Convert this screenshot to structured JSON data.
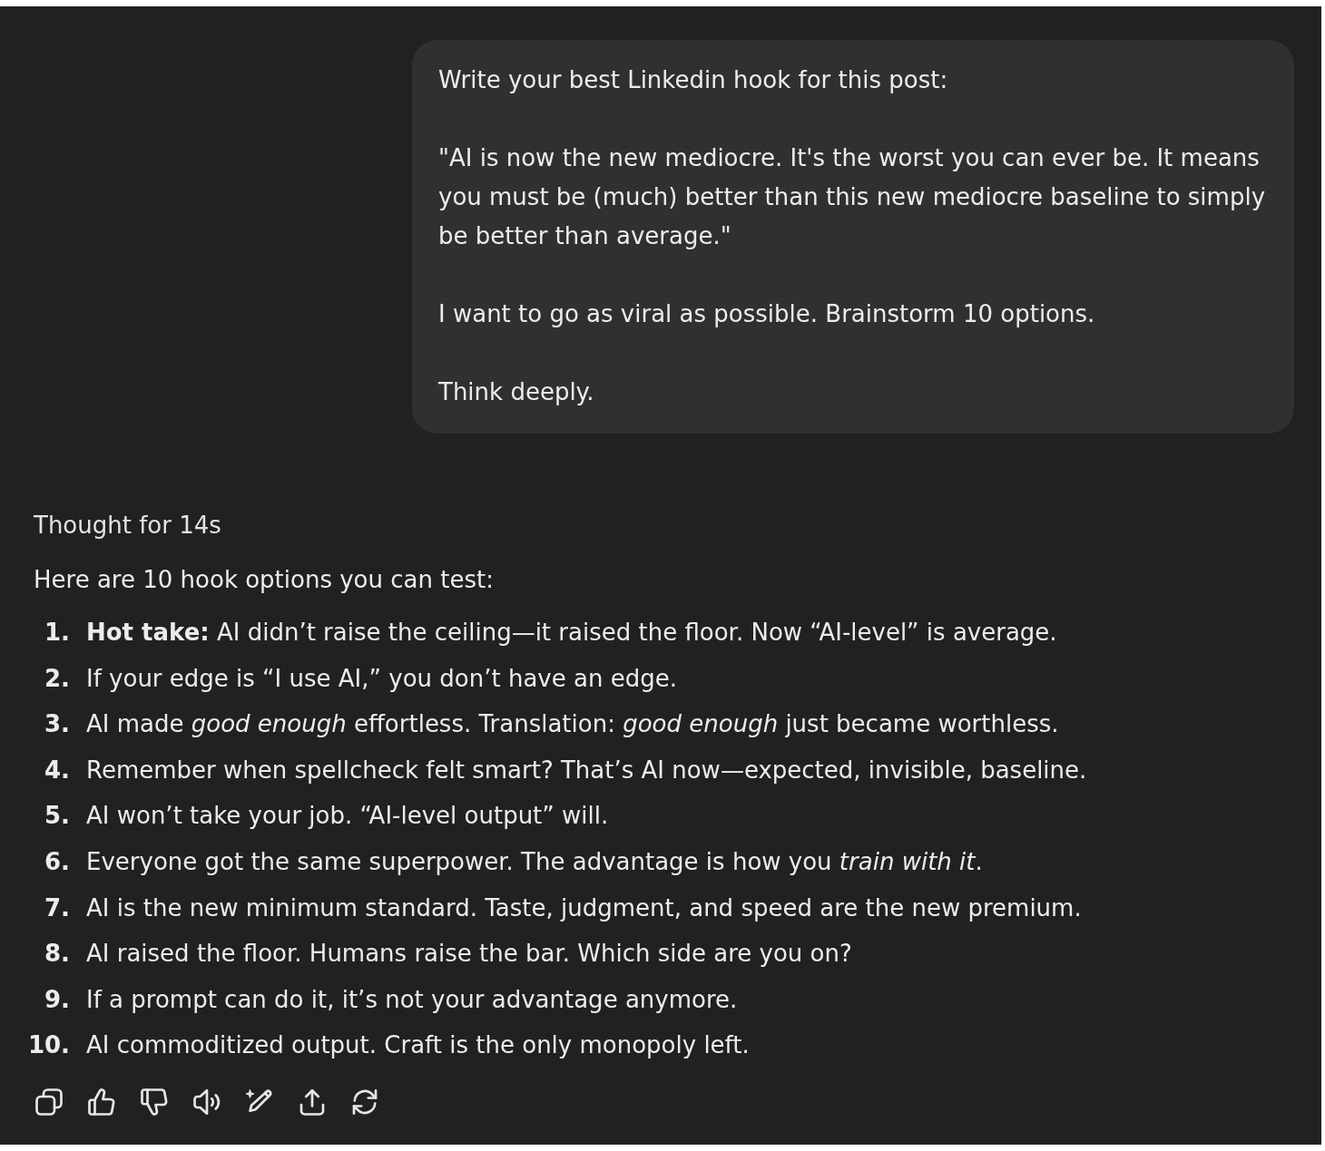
{
  "user_message": {
    "paragraphs": [
      "Write your best Linkedin hook for this post:",
      "\"AI is now the new mediocre. It's the worst you can ever be. It means you must be (much) better than this new mediocre baseline to simply be better than average.\"",
      "I want to go as viral as possible. Brainstorm 10 options.",
      "Think deeply."
    ]
  },
  "response": {
    "thought_label": "Thought for 14s",
    "intro": "Here are 10 hook options you can test:",
    "items": [
      {
        "number": "1.",
        "text": "**Hot take:** AI didn’t raise the ceiling—it raised the floor. Now “AI-level” is average."
      },
      {
        "number": "2.",
        "text": "If your edge is “I use AI,” you don’t have an edge."
      },
      {
        "number": "3.",
        "text": "AI made *good enough* effortless. Translation: *good enough* just became worthless."
      },
      {
        "number": "4.",
        "text": "Remember when spellcheck felt smart? That’s AI now—expected, invisible, baseline."
      },
      {
        "number": "5.",
        "text": "AI won’t take your job. “AI-level output” will."
      },
      {
        "number": "6.",
        "text": "Everyone got the same superpower. The advantage is how you *train with it*."
      },
      {
        "number": "7.",
        "text": "AI is the new minimum standard. Taste, judgment, and speed are the new premium."
      },
      {
        "number": "8.",
        "text": "AI raised the floor. Humans raise the bar. Which side are you on?"
      },
      {
        "number": "9.",
        "text": "If a prompt can do it, it’s not your advantage anymore."
      },
      {
        "number": "10.",
        "text": "AI commoditized output. Craft is the only monopoly left."
      }
    ]
  }
}
